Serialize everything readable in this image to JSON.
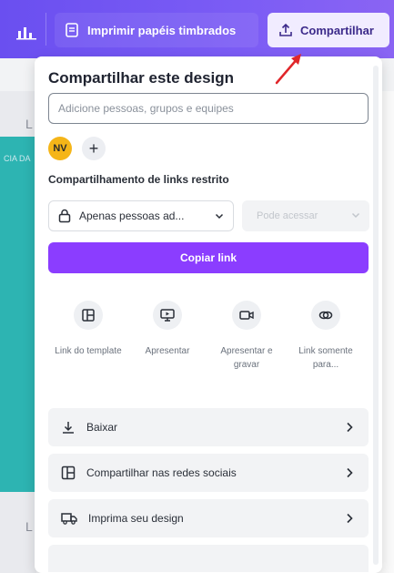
{
  "toolbar": {
    "print_label": "Imprimir papéis timbrados",
    "share_label": "Compartilhar"
  },
  "canvas": {
    "side_text": "CIA DA",
    "letter_top": "L",
    "letter_bottom": "L"
  },
  "share_panel": {
    "title": "Compartilhar este design",
    "search_placeholder": "Adicione pessoas, grupos e equipes",
    "avatar_initials": "NV",
    "add_person_symbol": "+",
    "link_heading": "Compartilhamento de links restrito",
    "access_value": "Apenas pessoas ad...",
    "permission_value": "Pode acessar",
    "copy_link_label": "Copiar link",
    "options": [
      {
        "label": "Link do template",
        "icon": "template-icon"
      },
      {
        "label": "Apresentar",
        "icon": "present-icon"
      },
      {
        "label": "Apresentar e gravar",
        "icon": "record-icon"
      },
      {
        "label": "Link somente para...",
        "icon": "view-link-icon"
      }
    ],
    "actions": [
      {
        "label": "Baixar",
        "icon": "download-icon"
      },
      {
        "label": "Compartilhar nas redes sociais",
        "icon": "social-icon"
      },
      {
        "label": "Imprima seu design",
        "icon": "truck-icon"
      }
    ]
  },
  "colors": {
    "toolbar": "#7b5cf5",
    "primary_button": "#8b3dff",
    "avatar": "#f5b518",
    "teal": "#2db4b2",
    "arrow": "#e0262a"
  }
}
